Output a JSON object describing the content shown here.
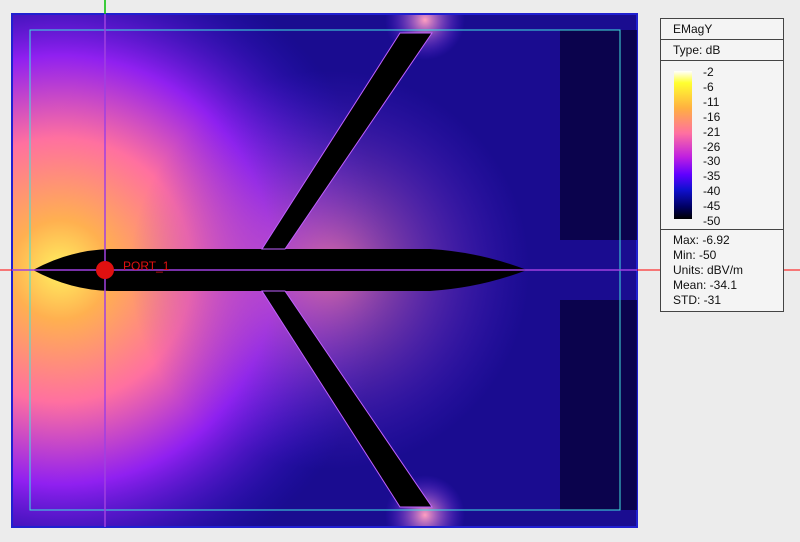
{
  "legend": {
    "title": "EMagY",
    "type": "Type: dB",
    "ticks": [
      "-2",
      "-6",
      "-11",
      "-16",
      "-21",
      "-26",
      "-30",
      "-35",
      "-40",
      "-45",
      "-50"
    ],
    "stats": [
      "Max: -6.92",
      "Min: -50",
      "Units: dBV/m",
      "Mean: -34.1",
      "STD: -31"
    ]
  },
  "port": {
    "label": "PORT_1",
    "color": "#e01010"
  },
  "colors": {
    "border": "#2020d0",
    "inner_box": "#40e0e0",
    "crosshair": "#a040e0",
    "axis_red": "#ff0000",
    "axis_green": "#00c000"
  }
}
